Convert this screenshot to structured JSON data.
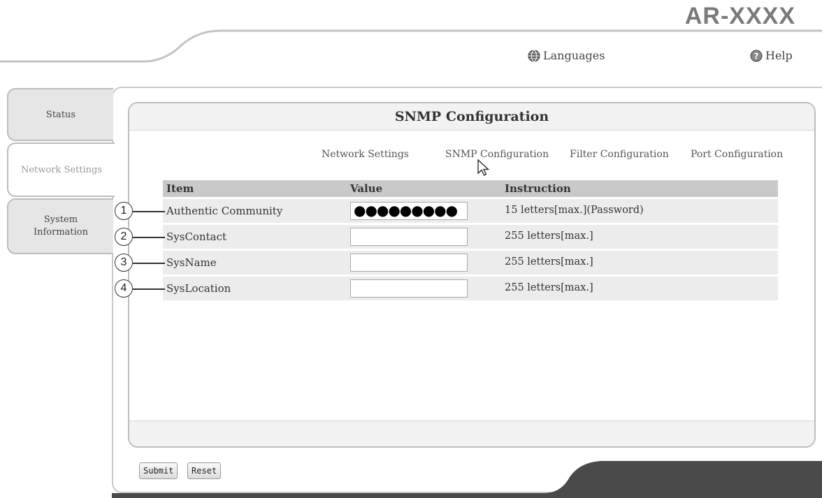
{
  "model": "AR-XXXX",
  "header": {
    "languages_label": "Languages",
    "help_label": "Help",
    "languages_icon": "globe-icon",
    "help_icon": "question-icon"
  },
  "sidebar": {
    "tabs": [
      {
        "label": "Status"
      },
      {
        "label": "Network Settings",
        "active": true
      },
      {
        "label": "System\nInformation"
      }
    ]
  },
  "panel": {
    "title": "SNMP Configuration",
    "subnav": [
      "Network Settings",
      "SNMP Configuration",
      "Filter Configuration",
      "Port Configuration"
    ]
  },
  "table": {
    "headers": [
      "Item",
      "Value",
      "Instruction"
    ],
    "rows": [
      {
        "callout": "1",
        "item": "Authentic Community",
        "value": "●●●●●●●●●",
        "instruction": "15 letters[max.](Password)"
      },
      {
        "callout": "2",
        "item": "SysContact",
        "value": "",
        "instruction": "255 letters[max.]"
      },
      {
        "callout": "3",
        "item": "SysName",
        "value": "",
        "instruction": "255 letters[max.]"
      },
      {
        "callout": "4",
        "item": "SysLocation",
        "value": "",
        "instruction": "255 letters[max.]"
      }
    ]
  },
  "buttons": {
    "submit": "Submit",
    "reset": "Reset"
  },
  "colors": {
    "table_header": "#c9c9c9",
    "row_bg": "#ececec",
    "tab_bg": "#e6e6e6",
    "bottom_bar": "#4a4a4a"
  }
}
